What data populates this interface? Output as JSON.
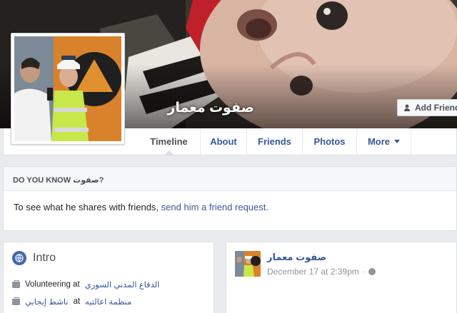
{
  "profile": {
    "name": "صفوت معمار",
    "add_friend_label": "Add Friend"
  },
  "nav": {
    "tabs": [
      {
        "label": "Timeline"
      },
      {
        "label": "About"
      },
      {
        "label": "Friends"
      },
      {
        "label": "Photos"
      },
      {
        "label": "More"
      }
    ]
  },
  "do_you_know": {
    "heading": "DO YOU KNOW صفوت?",
    "body_text": "To see what he shares with friends, ",
    "link_text": "send him a friend request."
  },
  "intro": {
    "title": "Intro",
    "items": [
      {
        "prefix": "Volunteering at ",
        "link": "الدفاع المدني السوري"
      },
      {
        "prefix": "",
        "link": "ناشط إيجابي",
        "middle": " at ",
        "link2": "منظمة اعالتيه"
      }
    ]
  },
  "post": {
    "author": "صفوت معمار",
    "timestamp": "December 17 at 2:39pm",
    "separator": "·"
  },
  "colors": {
    "link": "#365899",
    "background": "#e9ebee",
    "intro_globe": "#4267b2"
  },
  "icons": [
    "add-friend-icon",
    "globe-icon",
    "briefcase-icon",
    "public-icon",
    "dropdown-caret-icon"
  ]
}
